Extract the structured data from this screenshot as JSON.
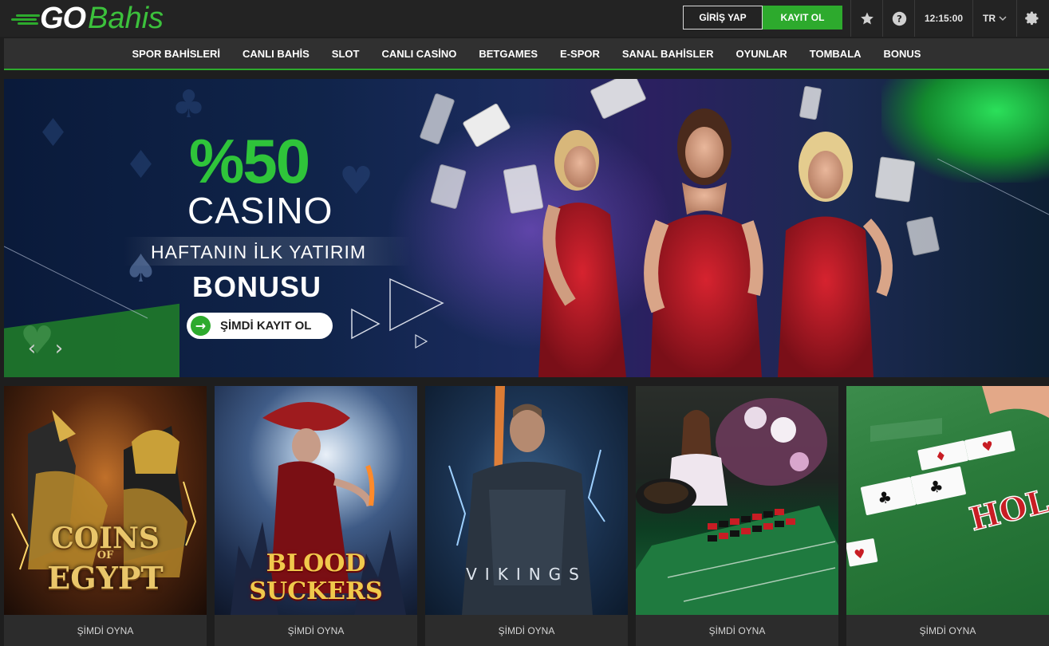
{
  "brand": {
    "go": "GO",
    "bahis": "Bahis",
    "green": "#2daa2d"
  },
  "header": {
    "login_label": "GİRİŞ YAP",
    "register_label": "KAYIT OL",
    "favorites_icon": "star-icon",
    "help_icon": "question-icon",
    "time": "12:15:00",
    "language": "TR",
    "settings_icon": "gear-icon"
  },
  "nav": {
    "items": [
      {
        "label": "SPOR BAHİSLERİ"
      },
      {
        "label": "CANLI BAHİS"
      },
      {
        "label": "SLOT"
      },
      {
        "label": "CANLI CASİNO"
      },
      {
        "label": "BETGAMES"
      },
      {
        "label": "E-SPOR"
      },
      {
        "label": "SANAL BAHİSLER"
      },
      {
        "label": "OYUNLAR"
      },
      {
        "label": "TOMBALA"
      },
      {
        "label": "BONUS"
      }
    ]
  },
  "hero": {
    "percent": "%50",
    "casino": "CASINO",
    "subtitle": "HAFTANIN İLK YATIRIM",
    "bonus": "BONUSU",
    "cta_label": "ŞİMDİ KAYIT OL",
    "prev_icon": "chevron-left-icon",
    "next_icon": "chevron-right-icon"
  },
  "games": [
    {
      "title_line1": "COINS",
      "title_of": "OF",
      "title_line2": "EGYPT",
      "play_label": "ŞİMDİ OYNA"
    },
    {
      "title": "BLOOD SUCKERS",
      "play_label": "ŞİMDİ OYNA"
    },
    {
      "title": "VIKINGS",
      "play_label": "ŞİMDİ OYNA"
    },
    {
      "play_label": "ŞİMDİ OYNA"
    },
    {
      "play_label": "ŞİMDİ OYNA"
    }
  ]
}
